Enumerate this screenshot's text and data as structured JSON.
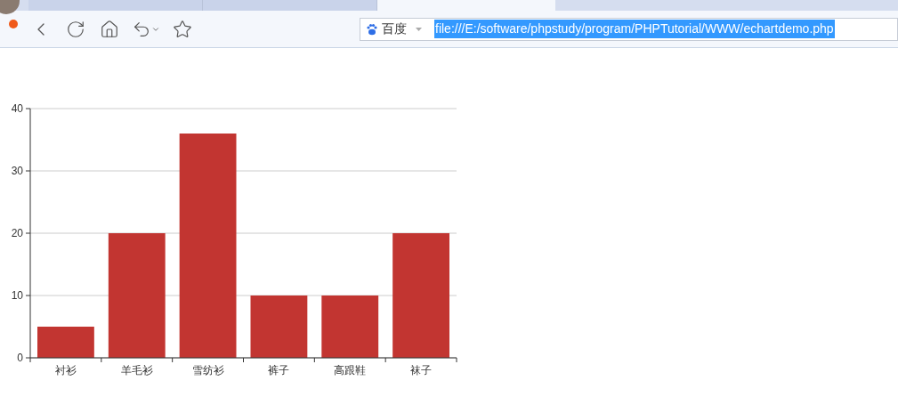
{
  "tabs": [
    {
      "selected": false
    },
    {
      "selected": false
    },
    {
      "selected": true
    }
  ],
  "address_bar": {
    "search_engine": "百度",
    "url": "file:///E:/software/phpstudy/program/PHPTutorial/WWW/echartdemo.php",
    "url_selected": true
  },
  "chart": {
    "chart_data": {
      "type": "bar",
      "categories": [
        "衬衫",
        "羊毛衫",
        "雪纺衫",
        "裤子",
        "高跟鞋",
        "袜子"
      ],
      "series": [
        {
          "color": "#c23531",
          "values": [
            5,
            20,
            36,
            10,
            10,
            20
          ]
        }
      ],
      "ylim": [
        0,
        40
      ],
      "yticks": [
        0,
        10,
        20,
        30,
        40
      ],
      "grid": true
    }
  }
}
